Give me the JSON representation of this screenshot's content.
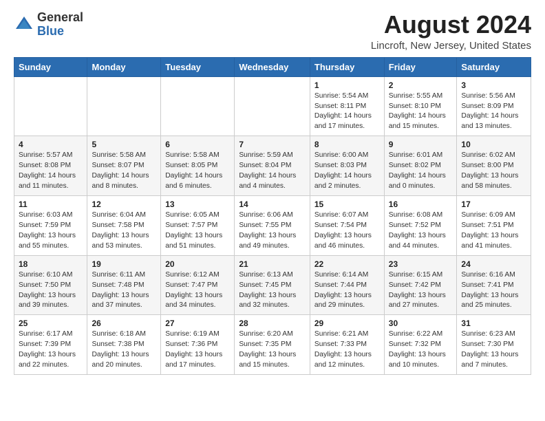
{
  "logo": {
    "general": "General",
    "blue": "Blue"
  },
  "title": "August 2024",
  "subtitle": "Lincroft, New Jersey, United States",
  "days_of_week": [
    "Sunday",
    "Monday",
    "Tuesday",
    "Wednesday",
    "Thursday",
    "Friday",
    "Saturday"
  ],
  "weeks": [
    [
      {
        "num": "",
        "content": ""
      },
      {
        "num": "",
        "content": ""
      },
      {
        "num": "",
        "content": ""
      },
      {
        "num": "",
        "content": ""
      },
      {
        "num": "1",
        "content": "Sunrise: 5:54 AM\nSunset: 8:11 PM\nDaylight: 14 hours\nand 17 minutes."
      },
      {
        "num": "2",
        "content": "Sunrise: 5:55 AM\nSunset: 8:10 PM\nDaylight: 14 hours\nand 15 minutes."
      },
      {
        "num": "3",
        "content": "Sunrise: 5:56 AM\nSunset: 8:09 PM\nDaylight: 14 hours\nand 13 minutes."
      }
    ],
    [
      {
        "num": "4",
        "content": "Sunrise: 5:57 AM\nSunset: 8:08 PM\nDaylight: 14 hours\nand 11 minutes."
      },
      {
        "num": "5",
        "content": "Sunrise: 5:58 AM\nSunset: 8:07 PM\nDaylight: 14 hours\nand 8 minutes."
      },
      {
        "num": "6",
        "content": "Sunrise: 5:58 AM\nSunset: 8:05 PM\nDaylight: 14 hours\nand 6 minutes."
      },
      {
        "num": "7",
        "content": "Sunrise: 5:59 AM\nSunset: 8:04 PM\nDaylight: 14 hours\nand 4 minutes."
      },
      {
        "num": "8",
        "content": "Sunrise: 6:00 AM\nSunset: 8:03 PM\nDaylight: 14 hours\nand 2 minutes."
      },
      {
        "num": "9",
        "content": "Sunrise: 6:01 AM\nSunset: 8:02 PM\nDaylight: 14 hours\nand 0 minutes."
      },
      {
        "num": "10",
        "content": "Sunrise: 6:02 AM\nSunset: 8:00 PM\nDaylight: 13 hours\nand 58 minutes."
      }
    ],
    [
      {
        "num": "11",
        "content": "Sunrise: 6:03 AM\nSunset: 7:59 PM\nDaylight: 13 hours\nand 55 minutes."
      },
      {
        "num": "12",
        "content": "Sunrise: 6:04 AM\nSunset: 7:58 PM\nDaylight: 13 hours\nand 53 minutes."
      },
      {
        "num": "13",
        "content": "Sunrise: 6:05 AM\nSunset: 7:57 PM\nDaylight: 13 hours\nand 51 minutes."
      },
      {
        "num": "14",
        "content": "Sunrise: 6:06 AM\nSunset: 7:55 PM\nDaylight: 13 hours\nand 49 minutes."
      },
      {
        "num": "15",
        "content": "Sunrise: 6:07 AM\nSunset: 7:54 PM\nDaylight: 13 hours\nand 46 minutes."
      },
      {
        "num": "16",
        "content": "Sunrise: 6:08 AM\nSunset: 7:52 PM\nDaylight: 13 hours\nand 44 minutes."
      },
      {
        "num": "17",
        "content": "Sunrise: 6:09 AM\nSunset: 7:51 PM\nDaylight: 13 hours\nand 41 minutes."
      }
    ],
    [
      {
        "num": "18",
        "content": "Sunrise: 6:10 AM\nSunset: 7:50 PM\nDaylight: 13 hours\nand 39 minutes."
      },
      {
        "num": "19",
        "content": "Sunrise: 6:11 AM\nSunset: 7:48 PM\nDaylight: 13 hours\nand 37 minutes."
      },
      {
        "num": "20",
        "content": "Sunrise: 6:12 AM\nSunset: 7:47 PM\nDaylight: 13 hours\nand 34 minutes."
      },
      {
        "num": "21",
        "content": "Sunrise: 6:13 AM\nSunset: 7:45 PM\nDaylight: 13 hours\nand 32 minutes."
      },
      {
        "num": "22",
        "content": "Sunrise: 6:14 AM\nSunset: 7:44 PM\nDaylight: 13 hours\nand 29 minutes."
      },
      {
        "num": "23",
        "content": "Sunrise: 6:15 AM\nSunset: 7:42 PM\nDaylight: 13 hours\nand 27 minutes."
      },
      {
        "num": "24",
        "content": "Sunrise: 6:16 AM\nSunset: 7:41 PM\nDaylight: 13 hours\nand 25 minutes."
      }
    ],
    [
      {
        "num": "25",
        "content": "Sunrise: 6:17 AM\nSunset: 7:39 PM\nDaylight: 13 hours\nand 22 minutes."
      },
      {
        "num": "26",
        "content": "Sunrise: 6:18 AM\nSunset: 7:38 PM\nDaylight: 13 hours\nand 20 minutes."
      },
      {
        "num": "27",
        "content": "Sunrise: 6:19 AM\nSunset: 7:36 PM\nDaylight: 13 hours\nand 17 minutes."
      },
      {
        "num": "28",
        "content": "Sunrise: 6:20 AM\nSunset: 7:35 PM\nDaylight: 13 hours\nand 15 minutes."
      },
      {
        "num": "29",
        "content": "Sunrise: 6:21 AM\nSunset: 7:33 PM\nDaylight: 13 hours\nand 12 minutes."
      },
      {
        "num": "30",
        "content": "Sunrise: 6:22 AM\nSunset: 7:32 PM\nDaylight: 13 hours\nand 10 minutes."
      },
      {
        "num": "31",
        "content": "Sunrise: 6:23 AM\nSunset: 7:30 PM\nDaylight: 13 hours\nand 7 minutes."
      }
    ]
  ]
}
